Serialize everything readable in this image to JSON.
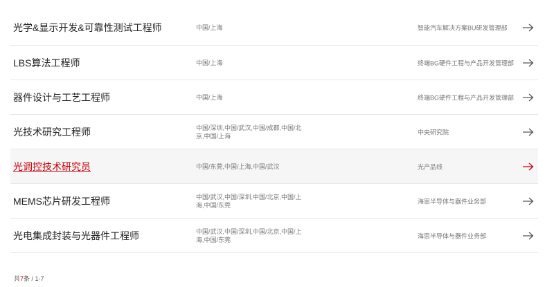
{
  "jobs": [
    {
      "title": "光学&显示开发&可靠性测试工程师",
      "location": "中国/上海",
      "department": "智能汽车解决方案BU研发管理部"
    },
    {
      "title": "LBS算法工程师",
      "location": "中国/上海",
      "department": "终端BG硬件工程与产品开发管理部"
    },
    {
      "title": "器件设计与工艺工程师",
      "location": "中国/上海",
      "department": "终端BG硬件工程与产品开发管理部"
    },
    {
      "title": "光技术研究工程师",
      "location": "中国/深圳,中国/武汉,中国/成都,中国/北京,中国/上海",
      "department": "中央研究院"
    },
    {
      "title": "光调控技术研究员",
      "location": "中国/东莞,中国/上海,中国/武汉",
      "department": "光产品线"
    },
    {
      "title": "MEMS芯片研发工程师",
      "location": "中国/武汉,中国/深圳,中国/北京,中国/上海,中国/东莞",
      "department": "海思半导体与器件业务部"
    },
    {
      "title": "光电集成封装与光器件工程师",
      "location": "中国/武汉,中国/深圳,中国/北京,中国/上海,中国/东莞",
      "department": "海思半导体与器件业务部"
    }
  ],
  "footer": {
    "prefix": "共",
    "count": "7",
    "suffix": "条 / 1-7"
  },
  "colors": {
    "accent": "#c7000b",
    "text": "#222222",
    "muted": "#777777",
    "divider": "#e6e6e6"
  },
  "icons": {
    "row_arrow": "arrow-right-icon"
  }
}
